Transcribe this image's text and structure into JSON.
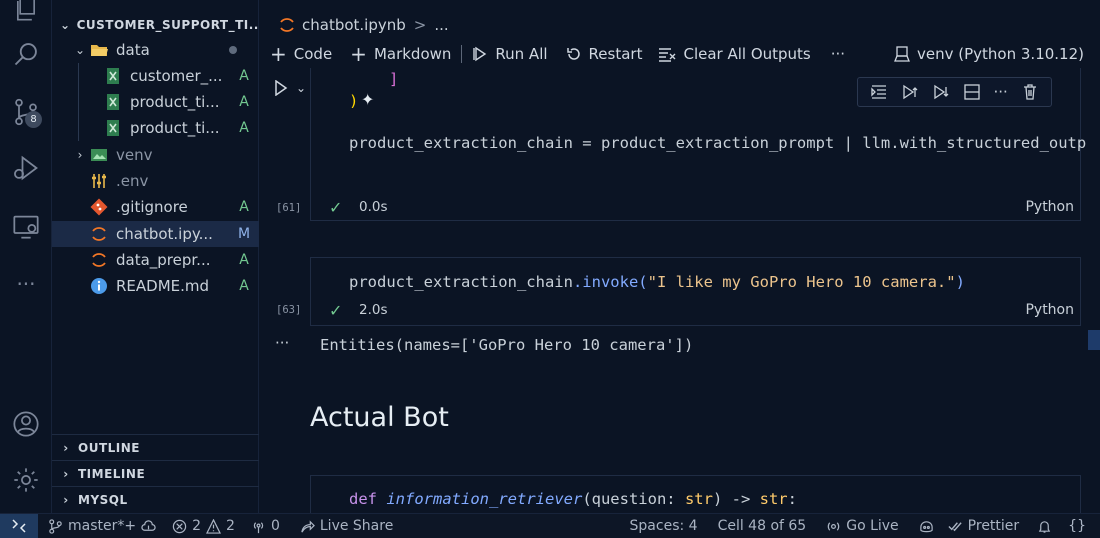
{
  "explorer": {
    "root_title": "CUSTOMER_SUPPORT_TI...",
    "items": [
      {
        "name": "data",
        "status": "",
        "type": "folder-open"
      },
      {
        "name": "customer_...",
        "status": "A",
        "type": "excel"
      },
      {
        "name": "product_ti...",
        "status": "A",
        "type": "excel"
      },
      {
        "name": "product_ti...",
        "status": "A",
        "type": "excel"
      },
      {
        "name": "venv",
        "status": "",
        "type": "folder-closed"
      },
      {
        "name": ".env",
        "status": "",
        "type": "env"
      },
      {
        "name": ".gitignore",
        "status": "A",
        "type": "git"
      },
      {
        "name": "chatbot.ipy...",
        "status": "M",
        "type": "jupyter"
      },
      {
        "name": "data_prepr...",
        "status": "A",
        "type": "jupyter"
      },
      {
        "name": "README.md",
        "status": "A",
        "type": "info"
      }
    ],
    "sections": [
      "OUTLINE",
      "TIMELINE",
      "MYSQL"
    ]
  },
  "activity": {
    "scm_badge": "8"
  },
  "breadcrumb": {
    "file": "chatbot.ipynb",
    "sep": ">",
    "more": "..."
  },
  "toolbar": {
    "code": "Code",
    "markdown": "Markdown",
    "run_all": "Run All",
    "restart": "Restart",
    "clear_outputs": "Clear All Outputs",
    "more": "···",
    "kernel": "venv (Python 3.10.12)"
  },
  "cells": {
    "cell1": {
      "line1": "]",
      "line2": ")",
      "line3_var": "product_extraction_chain",
      "line3_op": " = ",
      "line3_rest": "product_extraction_prompt | llm.with_structured_outp",
      "exec": "[61]",
      "time": "0.0s",
      "lang": "Python"
    },
    "cell2": {
      "obj": "product_extraction_chain",
      "method": ".invoke(",
      "arg": "\"I like my GoPro Hero 10 camera.\"",
      "close": ")",
      "exec": "[63]",
      "time": "2.0s",
      "lang": "Python",
      "output": "Entities(names=['GoPro Hero 10 camera'])",
      "output_menu": "···"
    },
    "heading": "Actual Bot",
    "cell3": {
      "kw": "def",
      "name": "information_retriever",
      "p1": "(question: ",
      "type1": "str",
      "p2": ") -> ",
      "type2": "str",
      "p3": ":"
    }
  },
  "statusbar": {
    "branch": "master*+",
    "errors": "2",
    "warnings": "2",
    "ports": "0",
    "live_share": "Live Share",
    "spaces": "Spaces: 4",
    "cell": "Cell 48 of 65",
    "go_live": "Go Live",
    "prettier": "Prettier",
    "braces": "{}"
  }
}
